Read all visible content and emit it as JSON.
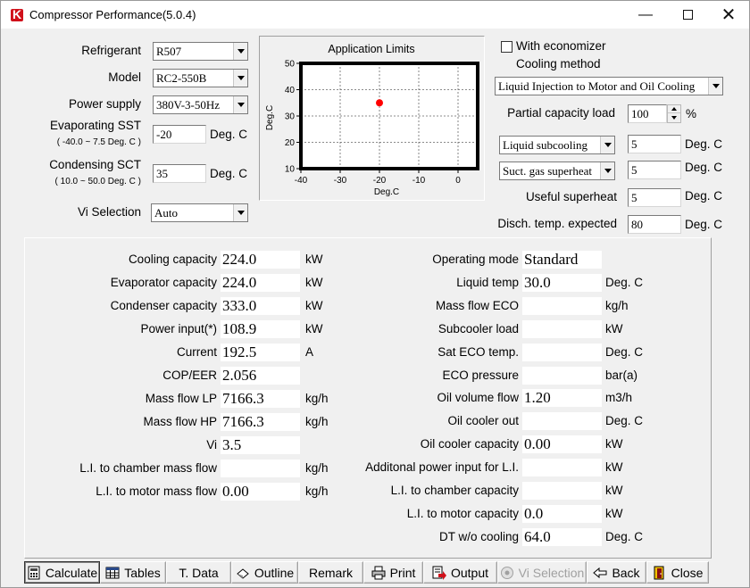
{
  "window": {
    "title": "Compressor Performance(5.0.4)"
  },
  "params": {
    "refrigerant": {
      "label": "Refrigerant",
      "value": "R507"
    },
    "model": {
      "label": "Model",
      "value": "RC2-550B"
    },
    "power": {
      "label": "Power supply",
      "value": "380V-3-50Hz"
    },
    "evap": {
      "label": "Evaporating SST",
      "range": "( -40.0 ~ 7.5 Deg. C )",
      "value": "-20",
      "unit": "Deg. C"
    },
    "cond": {
      "label": "Condensing SCT",
      "range": "( 10.0 ~ 50.0 Deg. C )",
      "value": "35",
      "unit": "Deg. C"
    },
    "vi": {
      "label": "Vi Selection",
      "value": "Auto"
    }
  },
  "chart_data": {
    "type": "scatter",
    "title": "Application Limits",
    "xlabel": "Deg.C",
    "ylabel": "Deg.C",
    "xlim": [
      -40,
      5
    ],
    "ylim": [
      10,
      50
    ],
    "xticks": [
      -40,
      -30,
      -20,
      -10,
      0
    ],
    "yticks": [
      10,
      20,
      30,
      40,
      50
    ],
    "grid": true,
    "points": [
      {
        "x": -20,
        "y": 35,
        "color": "#ff0000"
      }
    ]
  },
  "options": {
    "economizer": "With economizer",
    "cooling_method_label": "Cooling method",
    "cooling_method": "Liquid Injection to Motor and Oil Cooling",
    "partial_label": "Partial capacity load",
    "partial_value": "100",
    "partial_unit": "%",
    "subcool_mode": "Liquid subcooling",
    "subcool_value": "5",
    "superheat_mode": "Suct. gas superheat",
    "superheat_value": "5",
    "useful_label": "Useful superheat",
    "useful_value": "5",
    "disch_label": "Disch. temp. expected",
    "disch_value": "80",
    "unit": "Deg. C"
  },
  "results_left": [
    {
      "label": "Cooling capacity",
      "value": "224.0",
      "unit": "kW"
    },
    {
      "label": "Evaporator capacity",
      "value": "224.0",
      "unit": "kW"
    },
    {
      "label": "Condenser capacity",
      "value": "333.0",
      "unit": "kW"
    },
    {
      "label": "Power input(*)",
      "value": "108.9",
      "unit": "kW"
    },
    {
      "label": "Current",
      "value": "192.5",
      "unit": "A"
    },
    {
      "label": "COP/EER",
      "value": "2.056",
      "unit": ""
    },
    {
      "label": "Mass flow LP",
      "value": "7166.3",
      "unit": "kg/h"
    },
    {
      "label": "Mass flow HP",
      "value": "7166.3",
      "unit": "kg/h"
    },
    {
      "label": "Vi",
      "value": "3.5",
      "unit": ""
    },
    {
      "label": "L.I. to chamber mass flow",
      "value": "",
      "unit": "kg/h"
    },
    {
      "label": "L.I. to motor mass flow",
      "value": "0.00",
      "unit": "kg/h"
    }
  ],
  "results_right": [
    {
      "label": "Operating mode",
      "value": "Standard",
      "unit": ""
    },
    {
      "label": "Liquid temp",
      "value": "30.0",
      "unit": "Deg. C"
    },
    {
      "label": "Mass flow ECO",
      "value": "",
      "unit": "kg/h"
    },
    {
      "label": "Subcooler load",
      "value": "",
      "unit": "kW"
    },
    {
      "label": "Sat ECO temp.",
      "value": "",
      "unit": "Deg. C"
    },
    {
      "label": "ECO pressure",
      "value": "",
      "unit": "bar(a)"
    },
    {
      "label": "Oil volume flow",
      "value": "1.20",
      "unit": "m3/h"
    },
    {
      "label": "Oil cooler out",
      "value": "",
      "unit": "Deg. C"
    },
    {
      "label": "Oil cooler capacity",
      "value": "0.00",
      "unit": "kW"
    },
    {
      "label": "Additonal power input for L.I.",
      "value": "",
      "unit": "kW"
    },
    {
      "label": "L.I. to chamber capacity",
      "value": "",
      "unit": "kW"
    },
    {
      "label": "L.I. to motor capacity",
      "value": "0.0",
      "unit": "kW"
    },
    {
      "label": "DT w/o cooling",
      "value": "64.0",
      "unit": "Deg. C"
    }
  ],
  "buttons": {
    "calculate": "Calculate",
    "tables": "Tables",
    "tdata": "T. Data",
    "outline": "Outline",
    "remark": "Remark",
    "print": "Print",
    "output": "Output",
    "vi_selection": "Vi Selection",
    "back": "Back",
    "close": "Close"
  }
}
